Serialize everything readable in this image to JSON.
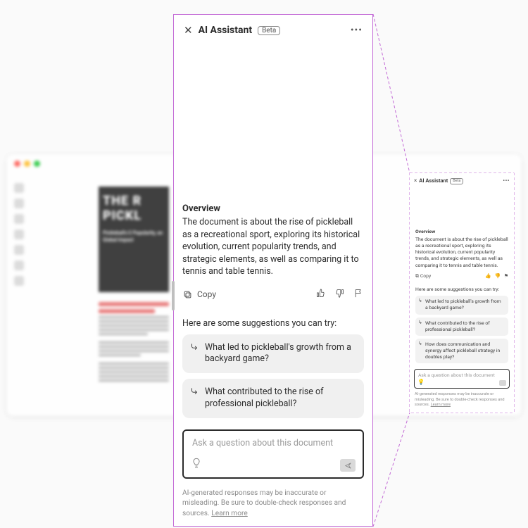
{
  "header": {
    "title": "AI Assistant",
    "beta_label": "Beta"
  },
  "overview": {
    "heading": "Overview",
    "body": "The document is about the rise of pickleball as a recreational sport, exploring its historical evolution, current popularity trends, and strategic elements, as well as comparing it to tennis and table tennis."
  },
  "actions": {
    "copy_label": "Copy"
  },
  "suggestions": {
    "heading": "Here are some suggestions you can try:",
    "items": [
      "What led to pickleball's growth from a backyard game?",
      "What contributed to the rise of professional pickleball?",
      "How does communication and synergy affect pickleball strategy in doubles play?"
    ]
  },
  "input": {
    "placeholder": "Ask a question about this document"
  },
  "disclaimer": {
    "text": "AI-generated responses may be inaccurate or misleading. Be sure to double-check responses and sources. ",
    "link": "Learn more"
  },
  "bg_doc": {
    "hero_line1": "THE R",
    "hero_line2": "PICKL",
    "hero_sub": "Pickleball's E\nPopularity, an\nGlobal Impact"
  }
}
